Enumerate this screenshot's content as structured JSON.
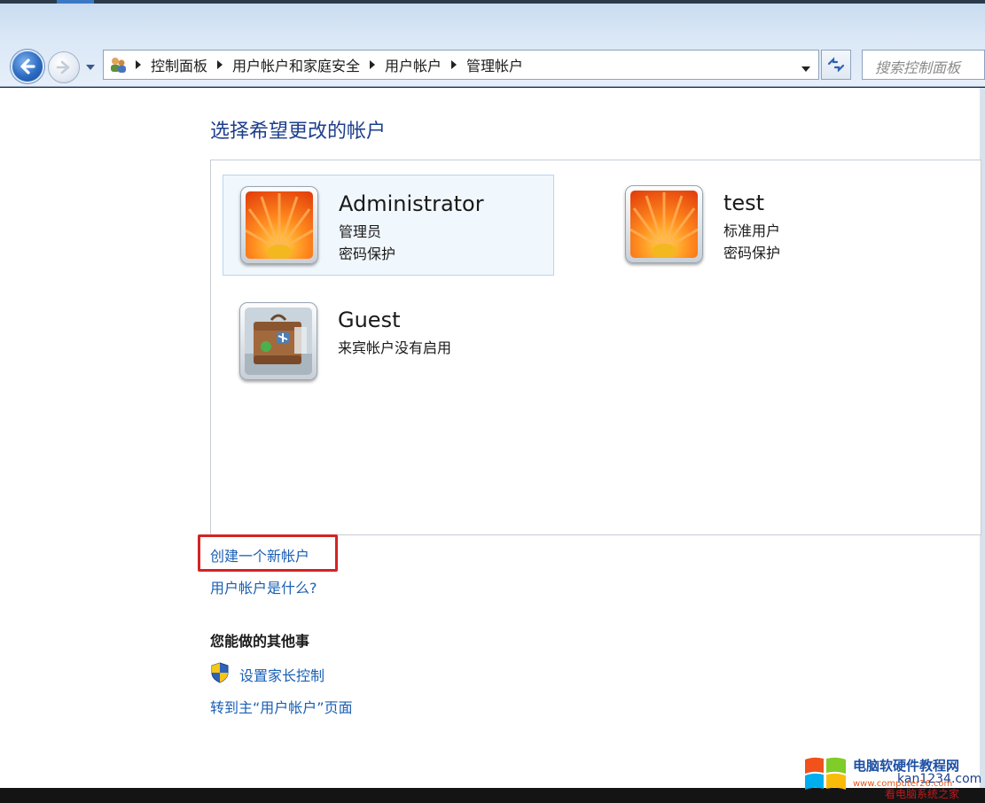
{
  "address_bar": {
    "crumbs": [
      "控制面板",
      "用户帐户和家庭安全",
      "用户帐户",
      "管理帐户"
    ]
  },
  "search": {
    "placeholder": "搜索控制面板"
  },
  "page": {
    "title": "选择希望更改的帐户"
  },
  "accounts": [
    {
      "name": "Administrator",
      "line1": "管理员",
      "line2": "密码保护",
      "selected": true,
      "avatar": "flower-icon"
    },
    {
      "name": "test",
      "line1": "标准用户",
      "line2": "密码保护",
      "selected": false,
      "avatar": "flower-icon"
    },
    {
      "name": "Guest",
      "line1": "来宾帐户没有启用",
      "line2": "",
      "selected": false,
      "avatar": "suitcase-icon"
    }
  ],
  "links": {
    "create_account": "创建一个新帐户",
    "what_is": "用户帐户是什么?"
  },
  "other_tasks": {
    "heading": "您能做的其他事",
    "parental_controls": "设置家长控制",
    "go_main": "转到主“用户帐户”页面"
  },
  "watermark": {
    "title": "电脑软硬件教程网",
    "url1": "kan1234.com",
    "url2": "www.computer26.com",
    "sub": "看电脑系统之家"
  },
  "colors": {
    "link": "#1a5fb4",
    "title": "#1e3f8c",
    "highlight": "#d42323"
  }
}
